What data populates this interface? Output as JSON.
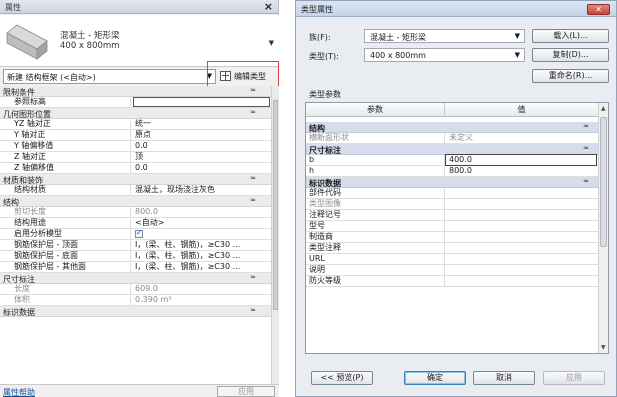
{
  "properties_panel": {
    "title": "属性",
    "close_glyph": "×",
    "type_line1": "混凝土 - 矩形梁",
    "type_line2": "400 x 800mm",
    "instance_selector": "新建 结构框架 (<自动>)",
    "edit_type_label": "编辑类型",
    "groups": [
      {
        "name": "限制条件",
        "rows": [
          {
            "name": "参照标高",
            "value": "",
            "editing": true
          }
        ]
      },
      {
        "name": "几何图形位置",
        "rows": [
          {
            "name": "YZ 轴对正",
            "value": "统一"
          },
          {
            "name": "Y 轴对正",
            "value": "原点"
          },
          {
            "name": "Y 轴偏移值",
            "value": "0.0"
          },
          {
            "name": "Z 轴对正",
            "value": "顶"
          },
          {
            "name": "Z 轴偏移值",
            "value": "0.0"
          }
        ]
      },
      {
        "name": "材质和装饰",
        "rows": [
          {
            "name": "结构材质",
            "value": "混凝土，现场浇注灰色"
          }
        ]
      },
      {
        "name": "结构",
        "rows": [
          {
            "name": "剪切长度",
            "value": "800.0",
            "dim": true
          },
          {
            "name": "结构用途",
            "value": "<自动>"
          },
          {
            "name": "启用分析模型",
            "value": "",
            "checkbox": true,
            "checked": true
          },
          {
            "name": "钢筋保护层 - 顶面",
            "value": "I，(梁、柱、钢筋)，≥C30 ..."
          },
          {
            "name": "钢筋保护层 - 底面",
            "value": "I，(梁、柱、钢筋)，≥C30 ..."
          },
          {
            "name": "钢筋保护层 - 其他面",
            "value": "I，(梁、柱、钢筋)，≥C30 ..."
          }
        ]
      },
      {
        "name": "尺寸标注",
        "rows": [
          {
            "name": "长度",
            "value": "609.0",
            "dim": true
          },
          {
            "name": "体积",
            "value": "0.390 m³",
            "dim": true
          }
        ]
      },
      {
        "name": "标识数据",
        "rows": []
      }
    ],
    "collapse_glyph": "≈",
    "help_link": "属性帮助",
    "apply_label": "应用"
  },
  "type_dialog": {
    "title": "类型属性",
    "close_glyph": "✕",
    "family_label": "族(F):",
    "family_value": "混凝土 - 矩形梁",
    "type_label": "类型(T):",
    "type_value": "400 x 800mm",
    "load_button": "载入(L)...",
    "duplicate_button": "复制(D)...",
    "rename_button": "重命名(R)...",
    "section_title": "类型参数",
    "col_param": "参数",
    "col_value": "值",
    "groups": [
      {
        "name": "结构",
        "rows": [
          {
            "name": "横断面形状",
            "value": "未定义",
            "dim": true
          }
        ]
      },
      {
        "name": "尺寸标注",
        "rows": [
          {
            "name": "b",
            "value": "400.0",
            "editing": true
          },
          {
            "name": "h",
            "value": "800.0"
          }
        ]
      },
      {
        "name": "标识数据",
        "rows": [
          {
            "name": "部件代码",
            "value": ""
          },
          {
            "name": "类型图像",
            "value": "",
            "dim": true
          },
          {
            "name": "注释记号",
            "value": ""
          },
          {
            "name": "型号",
            "value": ""
          },
          {
            "name": "制造商",
            "value": ""
          },
          {
            "name": "类型注释",
            "value": ""
          },
          {
            "name": "URL",
            "value": ""
          },
          {
            "name": "说明",
            "value": ""
          },
          {
            "name": "防火等级",
            "value": ""
          }
        ]
      }
    ],
    "preview_button": "<< 预览(P)",
    "ok_button": "确定",
    "cancel_button": "取消",
    "apply_button": "应用"
  }
}
